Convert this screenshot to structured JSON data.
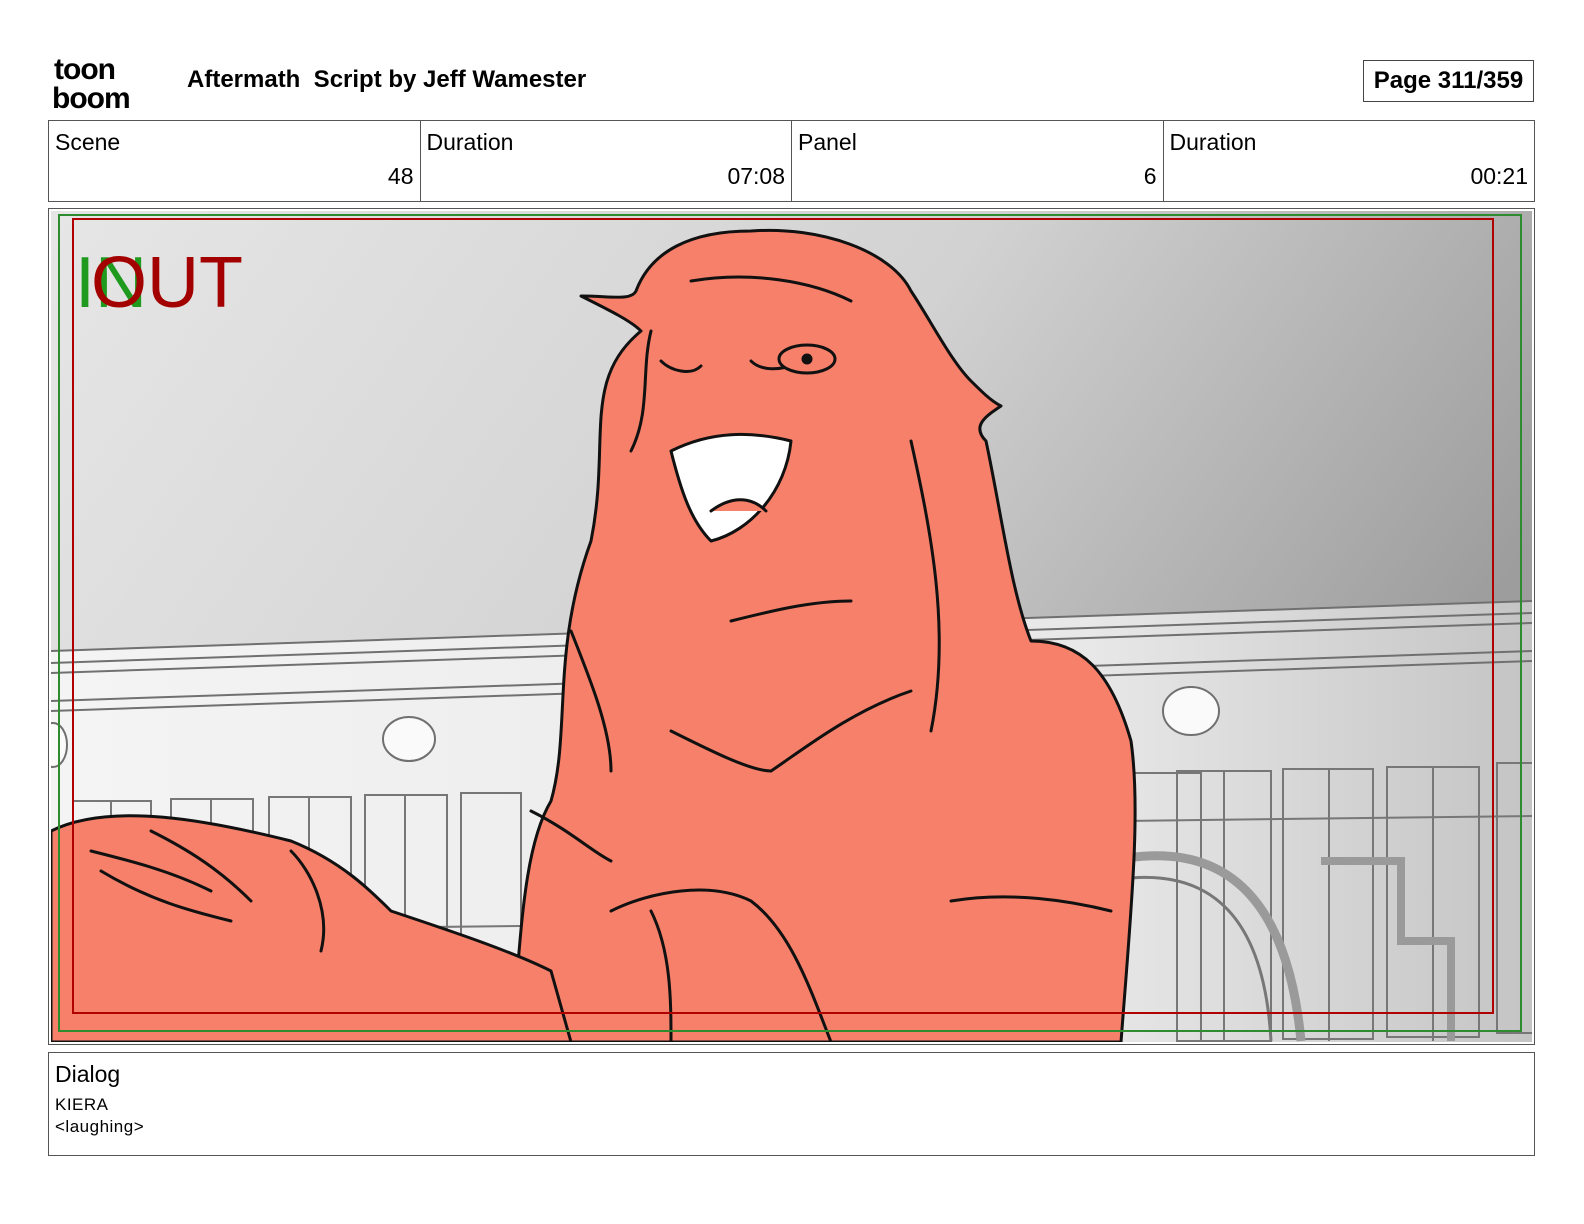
{
  "header": {
    "logo_text_top": "toon",
    "logo_text_bottom": "boom",
    "title": "Aftermath  Script by Jeff Wamester",
    "page": "Page 311/359"
  },
  "info": {
    "scene_label": "Scene",
    "scene_value": "48",
    "scene_duration_label": "Duration",
    "scene_duration_value": "07:08",
    "panel_label": "Panel",
    "panel_value": "6",
    "panel_duration_label": "Duration",
    "panel_duration_value": "00:21"
  },
  "panel": {
    "in_marker": "IN",
    "out_marker": "OUT",
    "colors": {
      "in": "#1f9a1f",
      "out": "#a30000",
      "character_fill": "#f6806a",
      "line": "#111111",
      "safe_green": "#2e8b2e",
      "safe_red": "#b00000"
    }
  },
  "dialog": {
    "label": "Dialog",
    "speaker": "KIERA",
    "line": "<laughing>"
  }
}
